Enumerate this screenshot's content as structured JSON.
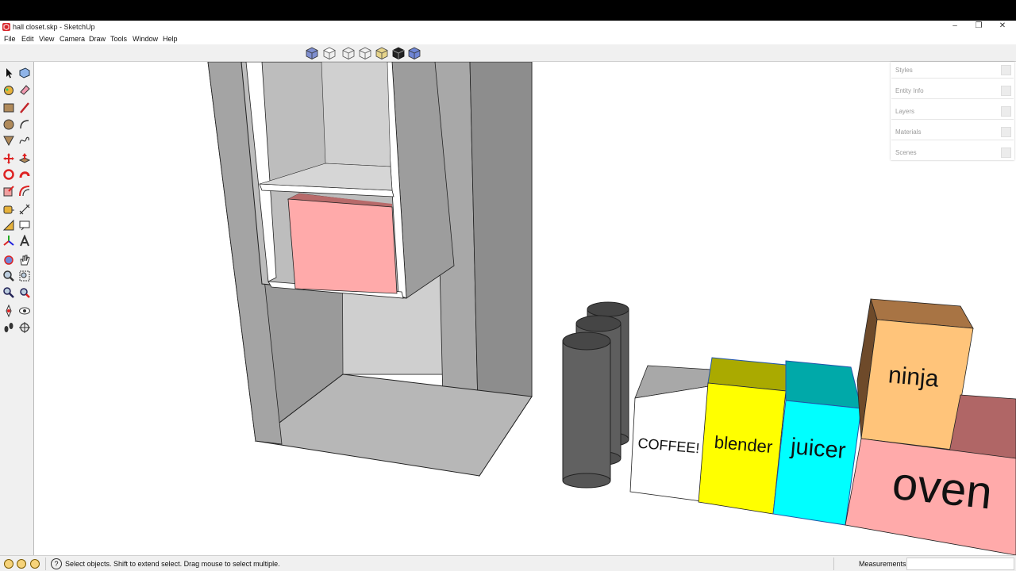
{
  "window": {
    "title": "hall closet.skp - SketchUp",
    "minimize": "–",
    "restore": "❐",
    "close": "✕"
  },
  "menu": [
    "File",
    "Edit",
    "View",
    "Camera",
    "Draw",
    "Tools",
    "Window",
    "Help"
  ],
  "view_toolbar": [
    "iso-view-icon",
    "top-view-icon",
    "front-view-icon",
    "right-view-icon",
    "back-view-icon",
    "left-view-icon",
    "wireframe-style-icon",
    "shaded-style-icon"
  ],
  "tray": {
    "panels": [
      "Styles",
      "Entity Info",
      "Layers",
      "Materials",
      "Scenes"
    ]
  },
  "scene": {
    "labels": {
      "coffee": "COFFEE!",
      "blender": "blender",
      "juicer": "juicer",
      "ninja": "ninja",
      "oven": "oven"
    },
    "colors": {
      "closet": "#9a9a9a",
      "pink_box": "#ffaaaa",
      "cylinder": "#595959",
      "coffee": "#ffffff",
      "blender": "#ffff00",
      "blender_top": "#aaaa00",
      "juicer": "#00ffff",
      "juicer_top": "#00a9a9",
      "ninja": "#ffc47a",
      "ninja_top": "#a87444",
      "oven": "#ffaaaa",
      "oven_top": "#b06666"
    }
  },
  "status": {
    "message": "Select objects. Shift to extend select. Drag mouse to select multiple.",
    "measurements_label": "Measurements",
    "help_glyph": "?"
  }
}
